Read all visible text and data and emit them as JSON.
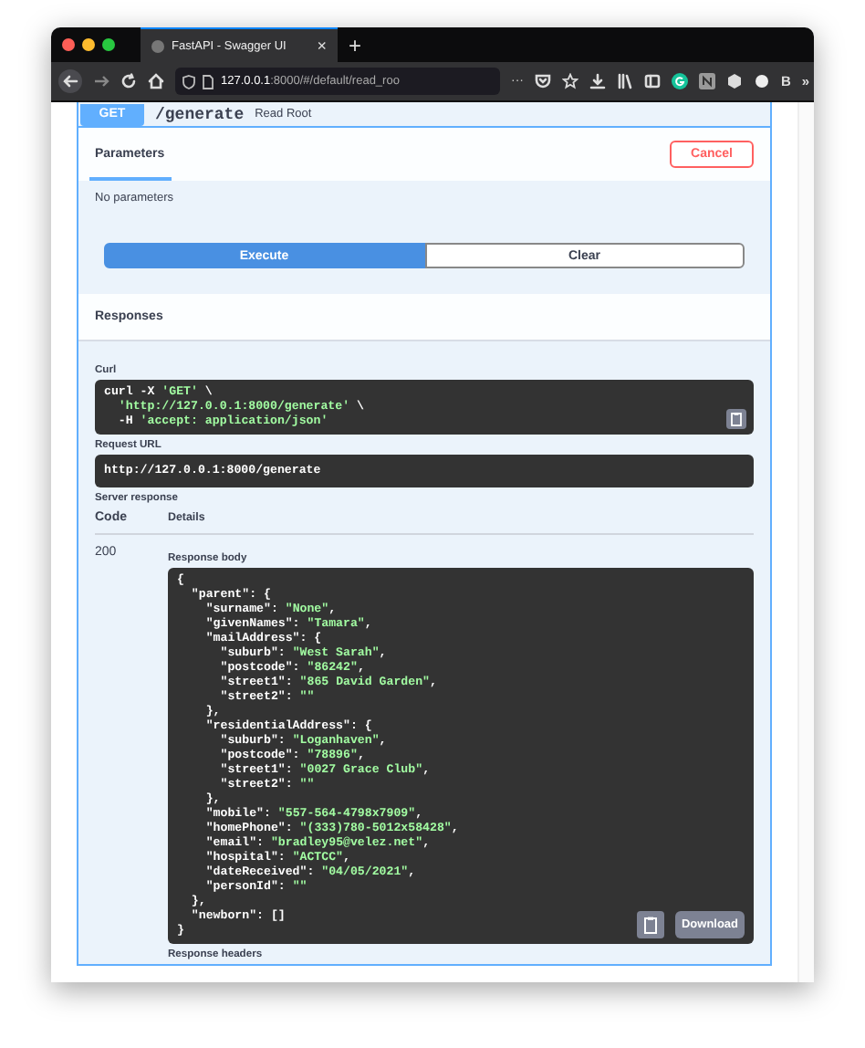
{
  "browser": {
    "tab_title": "FastAPI - Swagger UI",
    "tab_close": "×",
    "new_tab": "+",
    "url_host": "127.0.0.1",
    "url_rest": ":8000/#/default/read_roo",
    "url_more": "···",
    "extension_letter": "B",
    "overflow": "»"
  },
  "operation": {
    "method": "GET",
    "path": "/generate",
    "summary": "Read Root"
  },
  "parameters": {
    "title": "Parameters",
    "cancel": "Cancel",
    "empty": "No parameters"
  },
  "actions": [
    {
      "label": "Execute",
      "kind": "primary"
    },
    {
      "label": "Clear",
      "kind": "secondary"
    }
  ],
  "responses": {
    "title": "Responses",
    "curl_label": "Curl",
    "curl_lines": [
      "curl -X 'GET' \\",
      "  'http://127.0.0.1:8000/generate' \\",
      "  -H 'accept: application/json'"
    ],
    "request_url_label": "Request URL",
    "request_url": "http://127.0.0.1:8000/generate",
    "server_response_label": "Server response",
    "code_header": "Code",
    "details_header": "Details",
    "code": "200",
    "body_label": "Response body",
    "body_lines": [
      "{",
      "  \"parent\": {",
      "    \"surname\": \"None\",",
      "    \"givenNames\": \"Tamara\",",
      "    \"mailAddress\": {",
      "      \"suburb\": \"West Sarah\",",
      "      \"postcode\": \"86242\",",
      "      \"street1\": \"865 David Garden\",",
      "      \"street2\": \"\"",
      "    },",
      "    \"residentialAddress\": {",
      "      \"suburb\": \"Loganhaven\",",
      "      \"postcode\": \"78896\",",
      "      \"street1\": \"0027 Grace Club\",",
      "      \"street2\": \"\"",
      "    },",
      "    \"mobile\": \"557-564-4798x7909\",",
      "    \"homePhone\": \"(333)780-5012x58428\",",
      "    \"email\": \"bradley95@velez.net\",",
      "    \"hospital\": \"ACTCC\",",
      "    \"dateReceived\": \"04/05/2021\",",
      "    \"personId\": \"\"",
      "  },",
      "  \"newborn\": []",
      "}"
    ],
    "download": "Download",
    "headers_label": "Response headers"
  }
}
